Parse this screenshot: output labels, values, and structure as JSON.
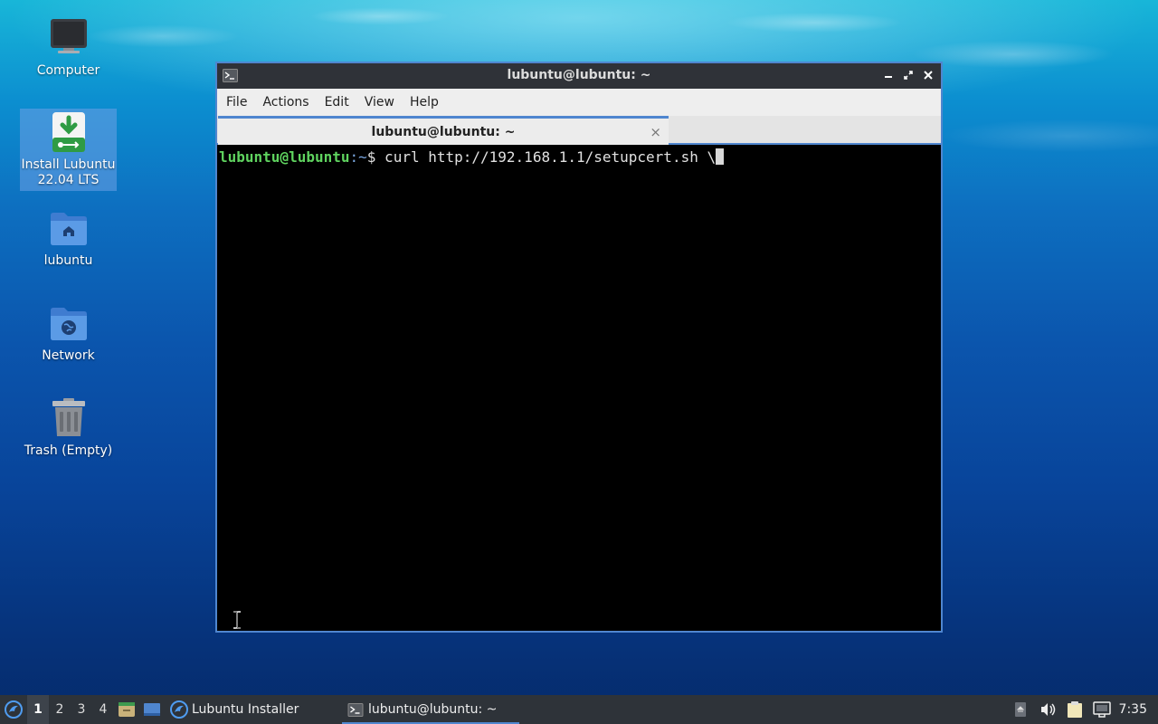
{
  "desktop": {
    "icons": [
      {
        "label": "Computer",
        "icon": "computer-icon"
      },
      {
        "label": "Install Lubuntu\n22.04 LTS",
        "icon": "installer-icon",
        "selected": true
      },
      {
        "label": "lubuntu",
        "icon": "home-folder-icon"
      },
      {
        "label": "Network",
        "icon": "network-folder-icon"
      },
      {
        "label": "Trash (Empty)",
        "icon": "trash-icon"
      }
    ]
  },
  "window": {
    "title": "lubuntu@lubuntu: ~",
    "controls": [
      "minimize-icon",
      "maximize-icon",
      "close-icon"
    ],
    "menu": [
      "File",
      "Actions",
      "Edit",
      "View",
      "Help"
    ],
    "tab": {
      "label": "lubuntu@lubuntu: ~",
      "close": "×"
    },
    "terminal": {
      "user": "lubuntu@lubuntu",
      "sep": ":",
      "path": "~",
      "symbol": "$",
      "command": " curl http://192.168.1.1/setupcert.sh \\"
    }
  },
  "taskbar": {
    "workspaces": [
      "1",
      "2",
      "3",
      "4"
    ],
    "active_workspace": "1",
    "tasks": [
      {
        "label": "Lubuntu Installer",
        "icon": "lubuntu-logo-icon"
      },
      {
        "label": "lubuntu@lubuntu: ~",
        "icon": "terminal-icon",
        "active": true
      }
    ],
    "clock": "7:35"
  },
  "colors": {
    "accent": "#4f86cf",
    "prompt_user": "#5fd35f",
    "prompt_path": "#7aa7e0",
    "taskbar_bg": "#2e3339"
  }
}
